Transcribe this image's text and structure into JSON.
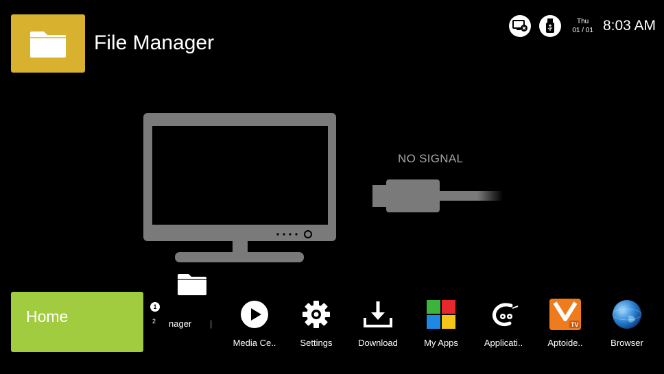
{
  "app": {
    "title": "File Manager"
  },
  "status": {
    "day": "Thu",
    "date": "01 / 01",
    "time": "8:03 AM"
  },
  "signal": {
    "text": "NO SIGNAL"
  },
  "home": {
    "label": "Home"
  },
  "focused": {
    "badge": "1",
    "index": "2",
    "label_partial": "nager",
    "tick": "|"
  },
  "dock": [
    {
      "label": "Media Ce..",
      "icon": "play-icon"
    },
    {
      "label": "Settings",
      "icon": "gear-icon"
    },
    {
      "label": "Download",
      "icon": "download-icon"
    },
    {
      "label": "My Apps",
      "icon": "apps-grid-icon"
    },
    {
      "label": "Applicati..",
      "icon": "application-icon"
    },
    {
      "label": "Aptoide..",
      "icon": "aptoide-tv-icon"
    },
    {
      "label": "Browser",
      "icon": "globe-icon"
    }
  ],
  "colors": {
    "app_tile": "#d8b12f",
    "home_tile": "#a2cc3f",
    "tv_gray": "#7a7a7a"
  }
}
